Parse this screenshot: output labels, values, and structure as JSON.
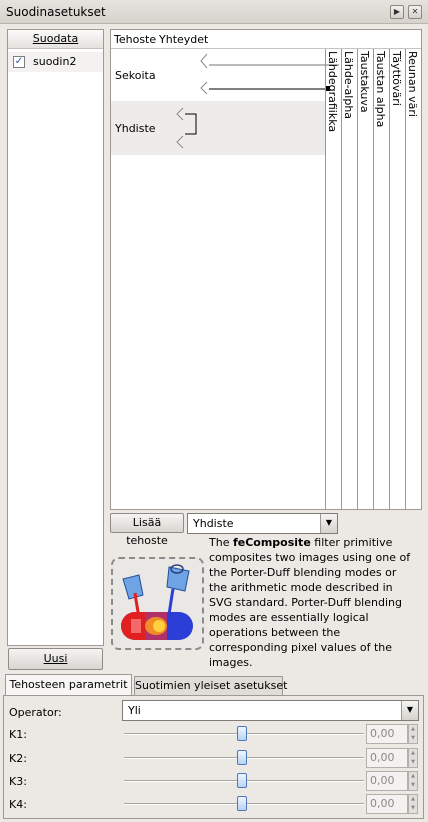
{
  "window": {
    "title": "Suodinasetukset"
  },
  "filters": {
    "header": "Suodata",
    "items": [
      {
        "label": "suodin2",
        "checked": true
      }
    ],
    "new_button": "Uusi"
  },
  "effects": {
    "col_effect": "Tehoste",
    "col_connections": "Yhteydet",
    "rows": [
      {
        "label": "Sekoita"
      },
      {
        "label": "Yhdiste"
      }
    ],
    "inputs": [
      "Lähdegrafiikka",
      "Lähde-alpha",
      "Taustakuva",
      "Taustan alpha",
      "Täyttöväri",
      "Reunan väri"
    ]
  },
  "add_effect": {
    "button": "Lisää tehoste",
    "selected": "Yhdiste"
  },
  "description": {
    "prefix": "The ",
    "name": "feComposite",
    "text": " filter primitive composites two images using one of the Porter-Duff blending modes or the arithmetic mode described in SVG standard. Porter-Duff blending modes are essentially logical operations between the corresponding pixel values of the images."
  },
  "tabs": [
    {
      "label": "Tehosteen parametrit",
      "active": true
    },
    {
      "label": "Suotimien yleiset asetukset",
      "active": false
    }
  ],
  "params": {
    "operator_label": "Operator:",
    "operator_value": "Yli",
    "sliders": [
      {
        "label": "K1:",
        "value": "0,00"
      },
      {
        "label": "K2:",
        "value": "0,00"
      },
      {
        "label": "K3:",
        "value": "0,00"
      },
      {
        "label": "K4:",
        "value": "0,00"
      }
    ]
  }
}
